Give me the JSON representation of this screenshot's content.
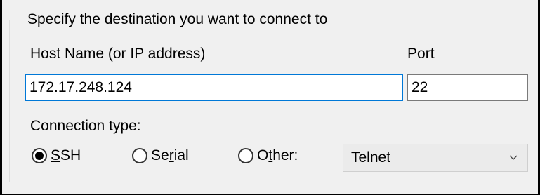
{
  "group": {
    "legend": "Specify the destination you want to connect to"
  },
  "host": {
    "label_before": "Host ",
    "label_accel": "N",
    "label_after": "ame (or IP address)",
    "value": "172.17.248.124"
  },
  "port": {
    "label_accel": "P",
    "label_after": "ort",
    "value": "22"
  },
  "connection_type": {
    "label": "Connection type:",
    "options": [
      {
        "accel": "S",
        "after": "SH",
        "checked": true
      },
      {
        "before": "Se",
        "accel": "r",
        "after": "ial",
        "checked": false
      },
      {
        "before": "O",
        "accel": "t",
        "after": "her:",
        "checked": false
      }
    ],
    "other_select": {
      "value": "Telnet",
      "icon": "chevron-down-icon"
    }
  }
}
